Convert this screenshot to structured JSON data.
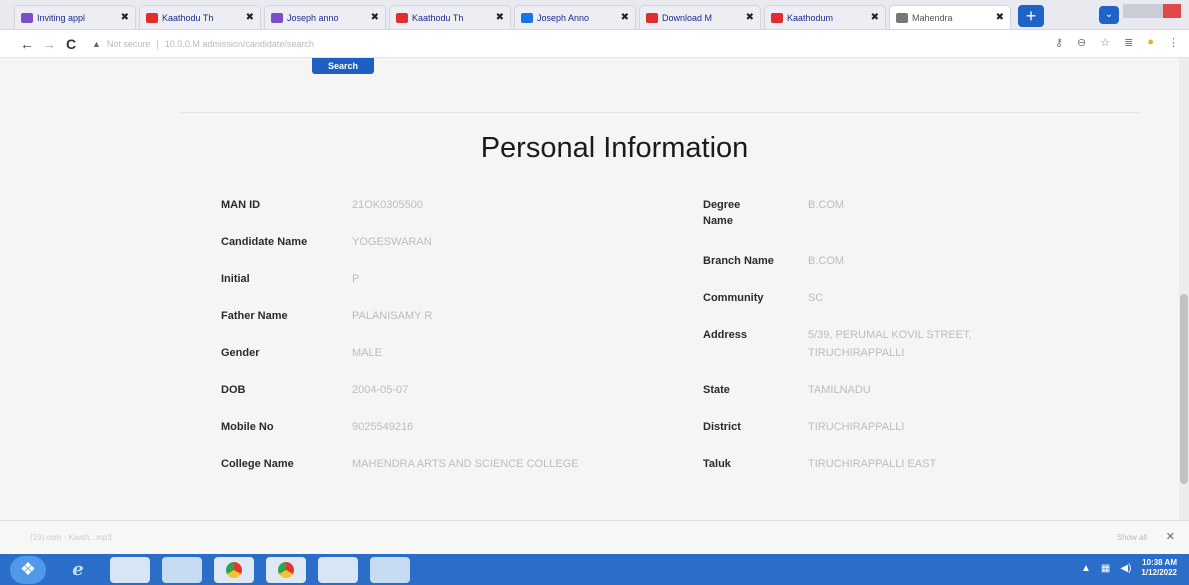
{
  "browser": {
    "tabs": [
      {
        "label": "Inviting appl",
        "favicon": "#7a4fc8"
      },
      {
        "label": "Kaathodu Th",
        "favicon": "#e02d2d"
      },
      {
        "label": "Joseph anno",
        "favicon": "#7a4fc8"
      },
      {
        "label": "Kaathodu Th",
        "favicon": "#e02d2d"
      },
      {
        "label": "Joseph Anno",
        "favicon": "#1a73e8"
      },
      {
        "label": "Download M",
        "favicon": "#e02d2d"
      },
      {
        "label": "Kaathodum",
        "favicon": "#e02d2d"
      },
      {
        "label": "Mahendra",
        "favicon": "#777777"
      }
    ],
    "new_tab_label": "+",
    "address": {
      "security": "Not secure",
      "url": "10.0.0.M admission/candidate/search"
    }
  },
  "page": {
    "search_button": "Search",
    "title": "Personal Information",
    "left_fields": [
      {
        "label": "MAN ID",
        "value": "21OK0305500"
      },
      {
        "label": "Candidate Name",
        "value": "YOGESWARAN"
      },
      {
        "label": "Initial",
        "value": "P"
      },
      {
        "label": "Father Name",
        "value": "PALANISAMY R"
      },
      {
        "label": "Gender",
        "value": "MALE"
      },
      {
        "label": "DOB",
        "value": "2004-05-07"
      },
      {
        "label": "Mobile No",
        "value": "9025549216"
      },
      {
        "label": "College Name",
        "value": "MAHENDRA ARTS AND SCIENCE COLLEGE"
      }
    ],
    "right_fields": [
      {
        "label": "Degree Name",
        "value": "B.COM"
      },
      {
        "label": "Branch Name",
        "value": "B.COM"
      },
      {
        "label": "Community",
        "value": "SC"
      },
      {
        "label": "Address",
        "value": "5/39, PERUMAL KOVIL STREET, TIRUCHIRAPPALLI"
      },
      {
        "label": "State",
        "value": "TAMILNADU"
      },
      {
        "label": "District",
        "value": "TIRUCHIRAPPALLI"
      },
      {
        "label": "Taluk",
        "value": "TIRUCHIRAPPALLI EAST"
      }
    ]
  },
  "downloads_bar": {
    "item": "(19).com - Kaath...mp3",
    "show_all": "Show all"
  },
  "taskbar": {
    "time": "10:38 AM",
    "date": "1/12/2022"
  }
}
